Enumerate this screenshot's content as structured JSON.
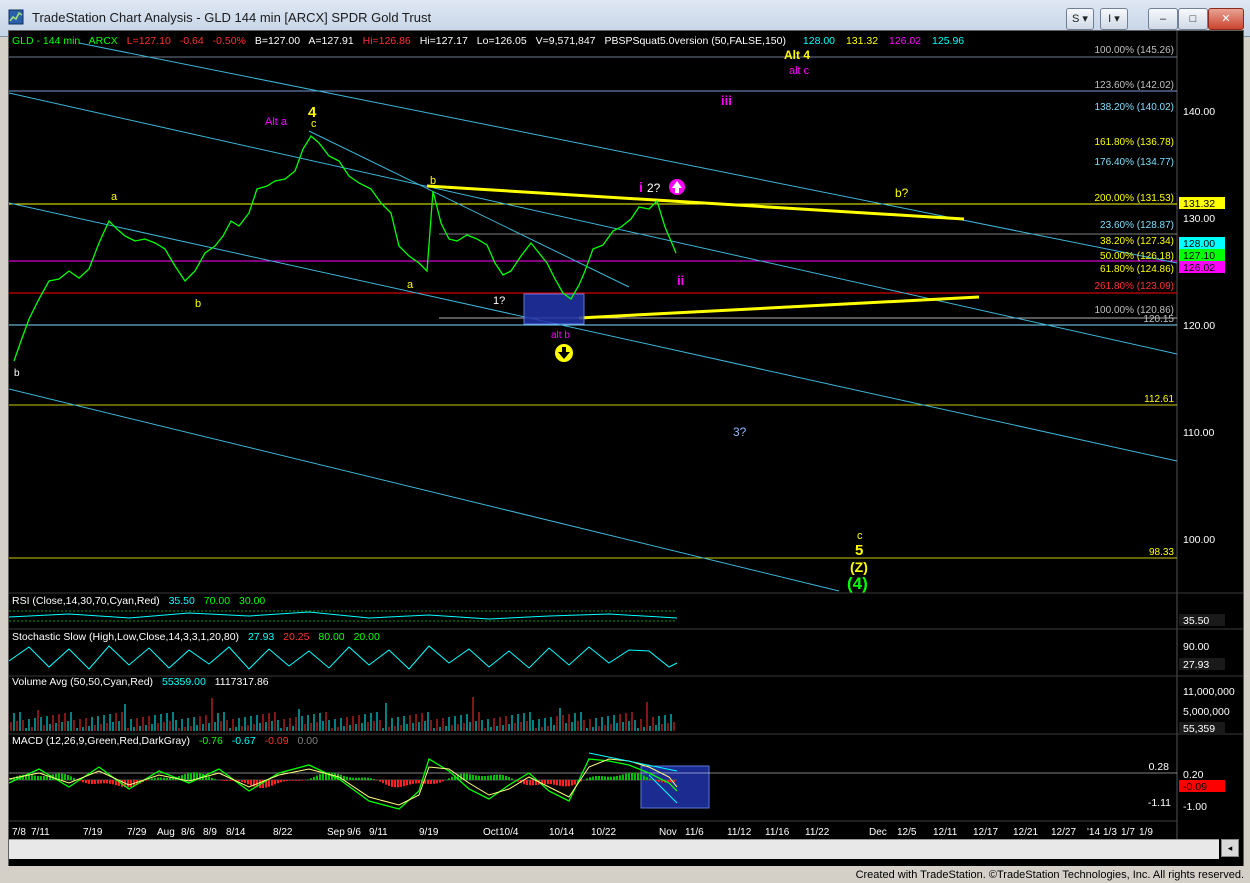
{
  "window": {
    "title": "TradeStation Chart Analysis - GLD 144 min [ARCX] SPDR Gold Trust",
    "buttons": {
      "s": "S",
      "i": "I",
      "min": "–",
      "max": "□",
      "close": "✕"
    }
  },
  "status_bar": {
    "credit": "Created with TradeStation. ©TradeStation Technologies, Inc. All rights reserved."
  },
  "header": {
    "symbol": "GLD - 144 min",
    "exchange": "ARCX",
    "last": "L=127.10",
    "change": "-0.64",
    "pct": "-0.50%",
    "bid": "B=127.00",
    "ask": "A=127.91",
    "high": "Hi=126.86",
    "close": "Hi=127.17",
    "low": "Lo=126.05",
    "volume": "V=9,571,847",
    "indicator": "PBSPSquat5.0version (50,FALSE,150)",
    "ind_vals": [
      "128.00",
      "131.32",
      "126.02",
      "125.96"
    ]
  },
  "price_axis": [
    "140.00",
    "130.00",
    "120.00",
    "110.00",
    "100.00"
  ],
  "price_boxes": [
    {
      "text": "131.32",
      "bg": "#ffff00",
      "fg": "#000000"
    },
    {
      "text": "128.00",
      "bg": "#00ffff",
      "fg": "#000000"
    },
    {
      "text": "127.10",
      "bg": "#00ff00",
      "fg": "#000000"
    },
    {
      "text": "126.02",
      "bg": "#ff00ff",
      "fg": "#000000"
    }
  ],
  "fib_labels": [
    "100.00% (145.26)",
    "123.60% (142.02)",
    "138.20% (140.02)",
    "161.80% (136.78)",
    "176.40% (134.77)",
    "200.00% (131.53)",
    "23.60% (128.87)",
    "38.20% (127.34)",
    "50.00% (126.18)",
    "61.80% (124.86)",
    "261.80% (123.09)",
    "100.00% (120.86)",
    "120.15",
    "112.61",
    "98.33"
  ],
  "wave_labels": {
    "alt4": "Alt 4",
    "altc": "alt c",
    "iii": "iii",
    "four": "4",
    "alta": "Alt a",
    "c_top": "c",
    "b_top": "b",
    "i": "i",
    "two_q": "2?",
    "b_q": "b?",
    "a_left": "a",
    "b_left": "b",
    "a_mid": "a",
    "one_q": "1?",
    "alt_b": "alt b",
    "ii": "ii",
    "b_low": "b",
    "three_q": "3?",
    "c_bot": "c",
    "five": "5",
    "z": "(Z)",
    "four_bot": "(4)"
  },
  "panels": {
    "rsi": {
      "label": "RSI (Close,14,30,70,Cyan,Red)",
      "v1": "35.50",
      "v2": "70.00",
      "v3": "30.00",
      "axis": [
        "35.50"
      ]
    },
    "stoch": {
      "label": "Stochastic Slow (High,Low,Close,14,3,3,1,20,80)",
      "v1": "27.93",
      "v2": "20.25",
      "v3": "80.00",
      "v4": "20.00",
      "axis": [
        "90.00",
        "27.93"
      ]
    },
    "volume": {
      "label": "Volume Avg (50,50,Cyan,Red)",
      "v1": "55359.00",
      "v2": "1117317.86",
      "axis": [
        "11,000,000",
        "5,000,000",
        "55,359"
      ]
    },
    "macd": {
      "label": "MACD (12,26,9,Green,Red,DarkGray)",
      "v1": "-0.76",
      "v2": "-0.67",
      "v3": "-0.09",
      "v4": "0.00",
      "axis": [
        "0.28",
        "0.20",
        "-0.09",
        "-1.11",
        "-1.00"
      ]
    }
  },
  "date_axis": [
    "7/8",
    "7/11",
    "7/19",
    "7/29",
    "Aug",
    "8/6",
    "8/9",
    "8/14",
    "8/22",
    "Sep",
    "9/6",
    "9/11",
    "9/19",
    "Oct",
    "10/4",
    "10/14",
    "10/22",
    "Nov",
    "11/6",
    "11/12",
    "11/16",
    "11/22",
    "Dec",
    "12/5",
    "12/11",
    "12/17",
    "12/21",
    "12/27",
    "'14",
    "1/3",
    "1/7",
    "1/9"
  ]
}
